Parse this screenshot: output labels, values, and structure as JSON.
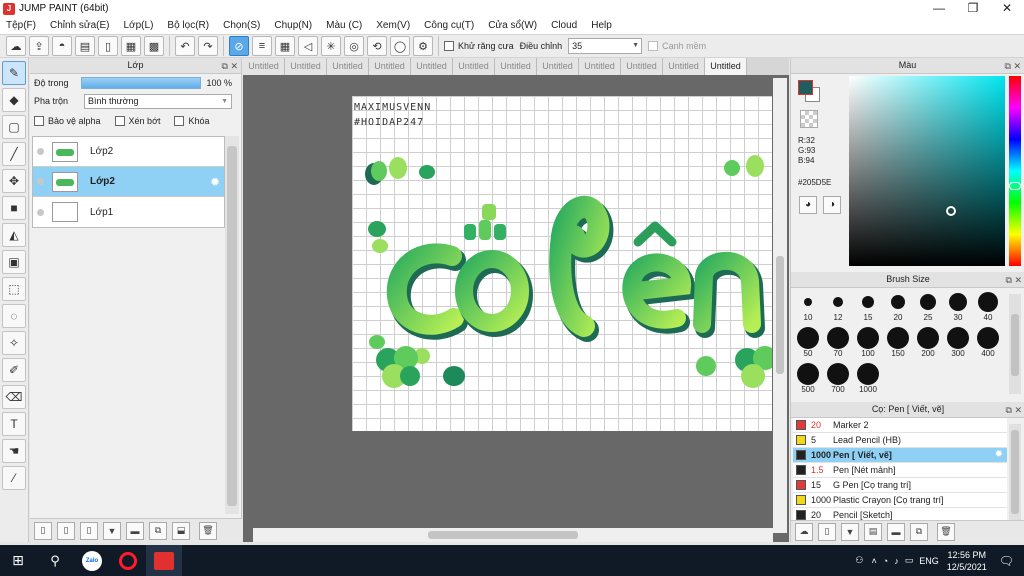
{
  "window": {
    "title": "JUMP PAINT (64bit)",
    "min": "—",
    "max": "❐",
    "close": "✕"
  },
  "menu": [
    "Tệp(F)",
    "Chỉnh sửa(E)",
    "Lớp(L)",
    "Bộ lọc(R)",
    "Chọn(S)",
    "Chụp(N)",
    "Màu (C)",
    "Xem(V)",
    "Công cụ(T)",
    "Cửa sổ(W)",
    "Cloud",
    "Help"
  ],
  "toolbar": {
    "antialias_label": "Khử răng cưa",
    "adjust_label": "Điều chỉnh",
    "adjust_value": "35",
    "canhmem_label": "Cạnh mềm"
  },
  "layer_panel": {
    "title": "Lớp",
    "opacity_label": "Độ trong",
    "opacity_value": "100 %",
    "opacity": 1.0,
    "blend_label": "Pha trộn",
    "blend_value": "Bình thường",
    "protect_alpha": "Bảo vệ alpha",
    "clip": "Xén bớt",
    "lock": "Khóa",
    "layers": [
      {
        "name": "Lớp2",
        "selected": false
      },
      {
        "name": "Lớp2",
        "selected": true
      },
      {
        "name": "Lớp1",
        "selected": false
      }
    ]
  },
  "tabs": [
    "Untitled",
    "Untitled",
    "Untitled",
    "Untitled",
    "Untitled",
    "Untitled",
    "Untitled",
    "Untitled",
    "Untitled",
    "Untitled",
    "Untitled",
    "Untitled"
  ],
  "canvas": {
    "watermark_line1": "MAXIMUSVENN",
    "watermark_line2": "#HOIDAP247"
  },
  "color_panel": {
    "title": "Màu",
    "r": "R:32",
    "g": "G:93",
    "b": "B:94",
    "hex": "#205D5E",
    "fg": "#205d5e"
  },
  "brush_panel": {
    "title": "Brush Size",
    "sizes": [
      "10",
      "12",
      "15",
      "20",
      "25",
      "30",
      "40",
      "50",
      "70",
      "100",
      "150",
      "200",
      "300",
      "400",
      "500",
      "700",
      "1000"
    ]
  },
  "tool_panel": {
    "title": "Cọ: Pen [ Viết, vẽ]",
    "items": [
      {
        "size": "20",
        "name": "Marker 2",
        "color": "#e03a3a",
        "red": true
      },
      {
        "size": "5",
        "name": "Lead Pencil (HB)",
        "color": "#f2d81a",
        "red": false
      },
      {
        "size": "1000",
        "name": "Pen [ Viết, vẽ]",
        "color": "#222222",
        "red": false,
        "selected": true
      },
      {
        "size": "1.5",
        "name": "Pen [Nét mảnh]",
        "color": "#222222",
        "red": true
      },
      {
        "size": "15",
        "name": "G Pen [Cọ trang trí]",
        "color": "#e03a3a",
        "red": false
      },
      {
        "size": "1000",
        "name": "Plastic Crayon [Cọ trang trí]",
        "color": "#f2d81a",
        "red": false
      },
      {
        "size": "20",
        "name": "Pencil [Sketch]",
        "color": "#222222",
        "red": false
      }
    ]
  },
  "taskbar": {
    "lang": "ENG",
    "time": "12:56 PM",
    "date": "12/5/2021",
    "zalo": "Zalo"
  }
}
